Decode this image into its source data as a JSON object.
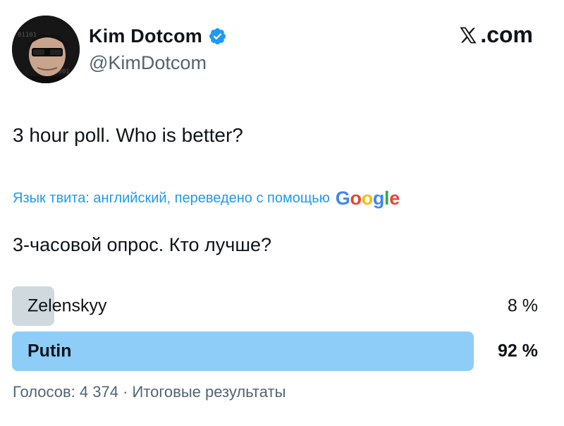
{
  "author": {
    "display_name": "Kim Dotcom",
    "handle": "@KimDotcom",
    "verified_icon": "verified-badge-icon",
    "avatar": "avatar"
  },
  "brand": {
    "text": ".com",
    "icon": "x-logo-icon"
  },
  "tweet": {
    "text": "3 hour poll. Who is better?"
  },
  "translation": {
    "note": "Язык твита: английский, переведено с помощью",
    "provider": "Google",
    "translated_text": "3-часовой опрос. Кто лучше?"
  },
  "poll": {
    "options": [
      {
        "label": "Zelenskyy",
        "percent_text": "8 %",
        "fraction": 0.08,
        "winner": false,
        "color": "#cfd9de"
      },
      {
        "label": "Putin",
        "percent_text": "92 %",
        "fraction": 0.92,
        "winner": true,
        "color": "#8ecdf8"
      }
    ],
    "footer": "Голосов: 4 374 · Итоговые результаты"
  },
  "colors": {
    "accent": "#1d9bf0",
    "secondary_text": "#536471",
    "primary_text": "#0f1419"
  }
}
